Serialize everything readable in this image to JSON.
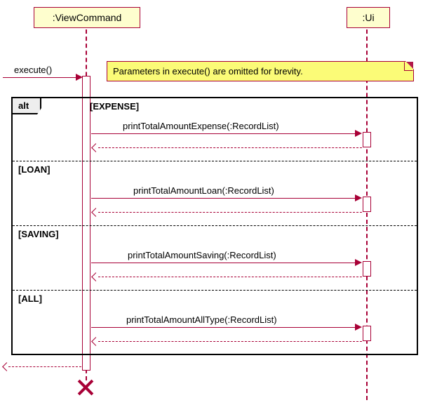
{
  "participants": {
    "viewCommand": {
      "label": ":ViewCommand"
    },
    "ui": {
      "label": ":Ui"
    }
  },
  "incoming_message": {
    "label": "execute()"
  },
  "note": {
    "text": "Parameters in execute() are omitted for brevity."
  },
  "alt": {
    "label": "alt",
    "sections": [
      {
        "guard": "[EXPENSE]",
        "message": "printTotalAmountExpense(:RecordList)"
      },
      {
        "guard": "[LOAN]",
        "message": "printTotalAmountLoan(:RecordList)"
      },
      {
        "guard": "[SAVING]",
        "message": "printTotalAmountSaving(:RecordList)"
      },
      {
        "guard": "[ALL]",
        "message": "printTotalAmountAllType(:RecordList)"
      }
    ]
  },
  "chart_data": {
    "type": "uml-sequence-diagram",
    "participants": [
      ":ViewCommand",
      ":Ui"
    ],
    "found_message": {
      "to": ":ViewCommand",
      "label": "execute()"
    },
    "note": "Parameters in execute() are omitted for brevity.",
    "fragment": {
      "type": "alt",
      "operands": [
        {
          "guard": "EXPENSE",
          "messages": [
            {
              "from": ":ViewCommand",
              "to": ":Ui",
              "label": "printTotalAmountExpense(:RecordList)",
              "sync": true
            },
            {
              "from": ":Ui",
              "to": ":ViewCommand",
              "label": "",
              "return": true
            }
          ]
        },
        {
          "guard": "LOAN",
          "messages": [
            {
              "from": ":ViewCommand",
              "to": ":Ui",
              "label": "printTotalAmountLoan(:RecordList)",
              "sync": true
            },
            {
              "from": ":Ui",
              "to": ":ViewCommand",
              "label": "",
              "return": true
            }
          ]
        },
        {
          "guard": "SAVING",
          "messages": [
            {
              "from": ":ViewCommand",
              "to": ":Ui",
              "label": "printTotalAmountSaving(:RecordList)",
              "sync": true
            },
            {
              "from": ":Ui",
              "to": ":ViewCommand",
              "label": "",
              "return": true
            }
          ]
        },
        {
          "guard": "ALL",
          "messages": [
            {
              "from": ":ViewCommand",
              "to": ":Ui",
              "label": "printTotalAmountAllType(:RecordList)",
              "sync": true
            },
            {
              "from": ":Ui",
              "to": ":ViewCommand",
              "label": "",
              "return": true
            }
          ]
        }
      ]
    },
    "return_to_caller": {
      "from": ":ViewCommand",
      "return": true
    },
    "destroy": ":ViewCommand"
  }
}
